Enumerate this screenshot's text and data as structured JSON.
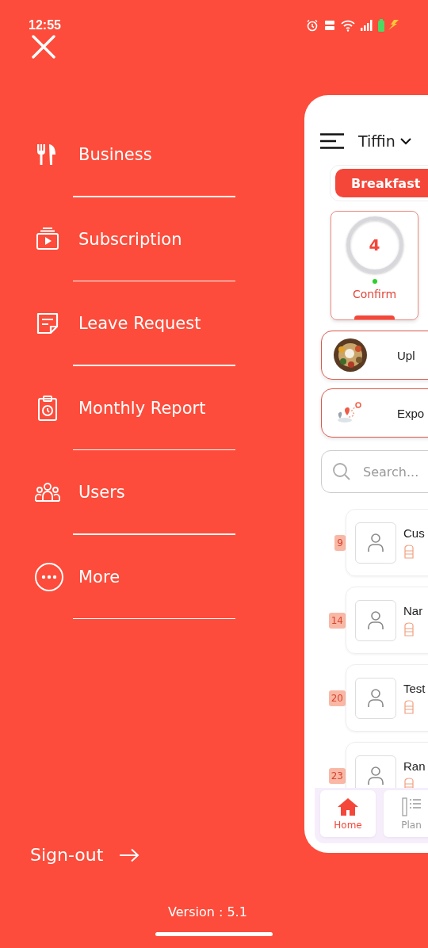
{
  "status_bar": {
    "time": "12:55"
  },
  "menu": [
    {
      "kind": "cutlery",
      "label": "Business"
    },
    {
      "kind": "play",
      "label": "Subscription"
    },
    {
      "kind": "note",
      "label": "Leave Request"
    },
    {
      "kind": "clipboard",
      "label": "Monthly Report"
    },
    {
      "kind": "users",
      "label": "Users"
    },
    {
      "kind": "more",
      "label": "More"
    }
  ],
  "sign_out": "Sign-out",
  "version": "Version : 5.1",
  "preview": {
    "title": "Tiffin",
    "meal_tab": "Breakfast",
    "status_card": {
      "count": "4",
      "label": "Confirm"
    },
    "actions": [
      {
        "kind": "picture",
        "label": "Upl"
      },
      {
        "kind": "route",
        "label": "Expo"
      }
    ],
    "search": {
      "placeholder": "Search..."
    },
    "customers": [
      {
        "number": "9",
        "name": "Cus"
      },
      {
        "number": "14",
        "name": "Nar"
      },
      {
        "number": "20",
        "name": "Test"
      },
      {
        "number": "23",
        "name": "Ran"
      }
    ],
    "nav": [
      {
        "kind": "home",
        "label": "Home",
        "selected": true
      },
      {
        "kind": "plan",
        "label": "Plan",
        "selected": false
      }
    ]
  }
}
